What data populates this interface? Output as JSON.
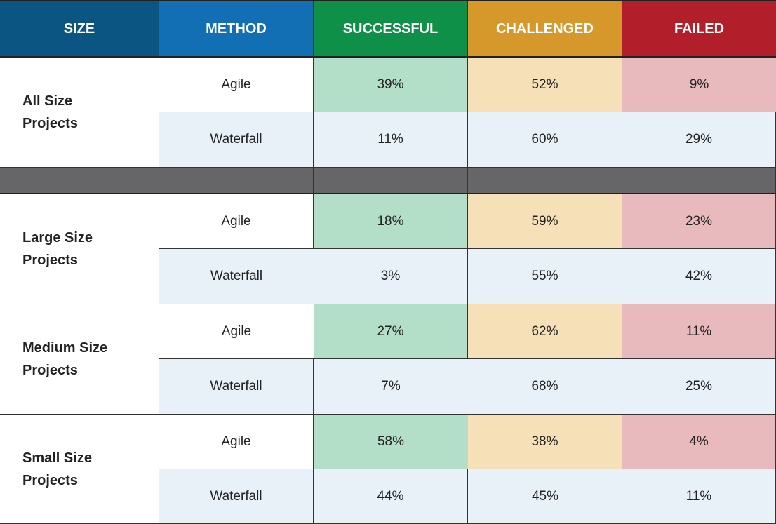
{
  "chart_data": {
    "type": "table",
    "columns": [
      "SIZE",
      "METHOD",
      "SUCCESSFUL",
      "CHALLENGED",
      "FAILED"
    ],
    "header_colors": [
      "#0b5582",
      "#136fb3",
      "#0e9048",
      "#d6982a",
      "#b21f2b"
    ],
    "cell_colors": {
      "successful": "#b3dfc8",
      "challenged": "#f5e0b7",
      "failed": "#e8babd",
      "waterfall_row": "#e8f0f8",
      "separator": "#666668"
    },
    "groups": [
      {
        "size": [
          "All Size",
          "Projects"
        ],
        "rows": [
          {
            "method": "Agile",
            "successful": "39%",
            "challenged": "52%",
            "failed": "9%"
          },
          {
            "method": "Waterfall",
            "successful": "11%",
            "challenged": "60%",
            "failed": "29%"
          }
        ]
      },
      {
        "size": [
          "Large Size",
          "Projects"
        ],
        "rows": [
          {
            "method": "Agile",
            "successful": "18%",
            "challenged": "59%",
            "failed": "23%"
          },
          {
            "method": "Waterfall",
            "successful": "3%",
            "challenged": "55%",
            "failed": "42%"
          }
        ]
      },
      {
        "size": [
          "Medium Size",
          "Projects"
        ],
        "rows": [
          {
            "method": "Agile",
            "successful": "27%",
            "challenged": "62%",
            "failed": "11%"
          },
          {
            "method": "Waterfall",
            "successful": "7%",
            "challenged": "68%",
            "failed": "25%"
          }
        ]
      },
      {
        "size": [
          "Small Size",
          "Projects"
        ],
        "rows": [
          {
            "method": "Agile",
            "successful": "58%",
            "challenged": "38%",
            "failed": "4%"
          },
          {
            "method": "Waterfall",
            "successful": "44%",
            "challenged": "45%",
            "failed": "11%"
          }
        ]
      }
    ]
  }
}
